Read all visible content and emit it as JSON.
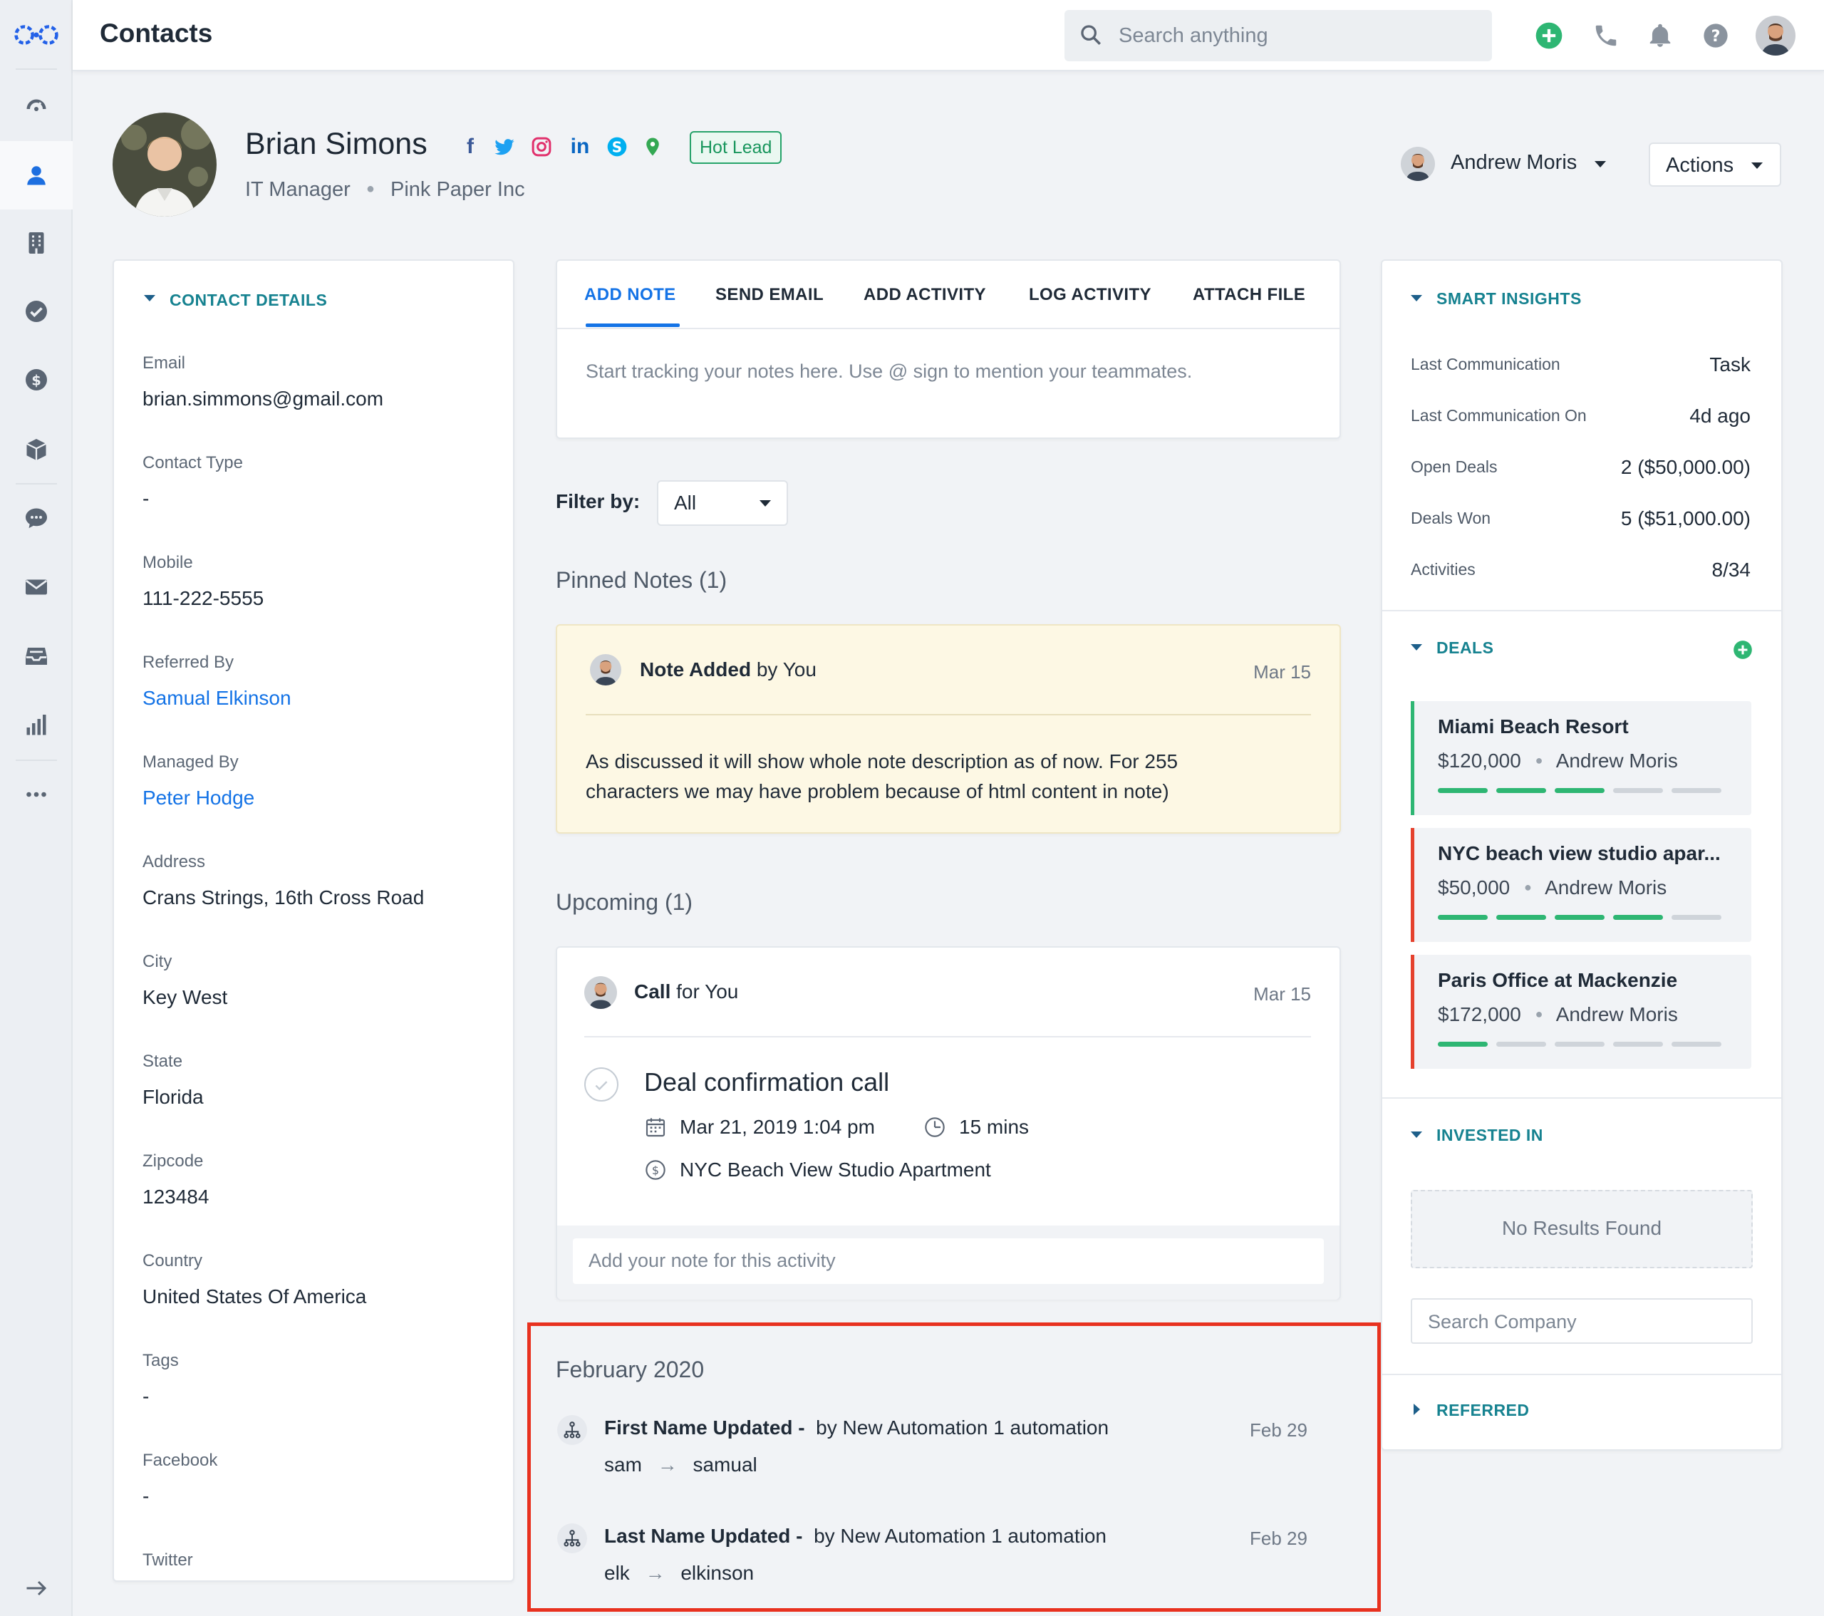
{
  "app": {
    "title": "Contacts"
  },
  "search": {
    "placeholder": "Search anything"
  },
  "contact": {
    "name": "Brian Simons",
    "job_title": "IT Manager",
    "company": "Pink Paper Inc",
    "badge": "Hot Lead",
    "owner": "Andrew Moris",
    "actions_label": "Actions"
  },
  "contact_details": {
    "title": "CONTACT DETAILS",
    "fields": [
      {
        "label": "Email",
        "value": "brian.simmons@gmail.com"
      },
      {
        "label": "Contact Type",
        "value": "-"
      },
      {
        "label": "Mobile",
        "value": "111-222-5555"
      },
      {
        "label": "Referred By",
        "value": "Samual Elkinson"
      },
      {
        "label": "Managed By",
        "value": "Peter Hodge"
      },
      {
        "label": "Address",
        "value": "Crans Strings, 16th Cross Road"
      },
      {
        "label": "City",
        "value": "Key West"
      },
      {
        "label": "State",
        "value": "Florida"
      },
      {
        "label": "Zipcode",
        "value": "123484"
      },
      {
        "label": "Country",
        "value": "United States Of America"
      },
      {
        "label": "Tags",
        "value": "-"
      },
      {
        "label": "Facebook",
        "value": "-"
      },
      {
        "label": "Twitter",
        "value": ""
      }
    ]
  },
  "composer": {
    "tabs": [
      "ADD NOTE",
      "SEND EMAIL",
      "ADD ACTIVITY",
      "LOG ACTIVITY",
      "ATTACH FILE"
    ],
    "placeholder": "Start tracking your notes here. Use @ sign to mention your teammates."
  },
  "filter": {
    "label": "Filter by:",
    "value": "All"
  },
  "pinned": {
    "heading": "Pinned Notes (1)",
    "note_title": "Note Added",
    "note_by": "by You",
    "date": "Mar 15",
    "body_line1": "As discussed it will show whole note description as of now. For 255",
    "body_line2": "characters we may have problem because of html content in note)"
  },
  "upcoming": {
    "heading": "Upcoming (1)",
    "activity_type": "Call",
    "activity_for": "for You",
    "date": "Mar 15",
    "title": "Deal confirmation call",
    "datetime": "Mar 21, 2019 1:04 pm",
    "duration": "15 mins",
    "deal": "NYC Beach View Studio Apartment",
    "note_placeholder": "Add your note for this activity"
  },
  "timeline": {
    "month": "February 2020",
    "items": [
      {
        "title": "First Name Updated -",
        "by": "by New Automation 1 automation",
        "date": "Feb 29",
        "from": "sam",
        "to": "samual"
      },
      {
        "title": "Last Name Updated -",
        "by": "by New Automation 1 automation",
        "date": "Feb 29",
        "from": "elk",
        "to": "elkinson"
      }
    ]
  },
  "insights": {
    "title": "SMART INSIGHTS",
    "rows": [
      {
        "label": "Last Communication",
        "value": "Task"
      },
      {
        "label": "Last Communication On",
        "value": "4d ago"
      },
      {
        "label": "Open Deals",
        "value": "2 ($50,000.00)"
      },
      {
        "label": "Deals Won",
        "value": "5 ($51,000.00)"
      },
      {
        "label": "Activities",
        "value": "8/34"
      }
    ]
  },
  "deals": {
    "title": "DEALS",
    "items": [
      {
        "name": "Miami Beach Resort",
        "amount": "$120,000",
        "owner": "Andrew Moris",
        "stage_progress": 3,
        "stage_total": 5,
        "status_color": "#2eb673"
      },
      {
        "name": "NYC beach view studio apar...",
        "amount": "$50,000",
        "owner": "Andrew Moris",
        "stage_progress": 4,
        "stage_total": 5,
        "status_color": "#e5412d"
      },
      {
        "name": "Paris Office at Mackenzie",
        "amount": "$172,000",
        "owner": "Andrew Moris",
        "stage_progress": 1,
        "stage_total": 5,
        "status_color": "#e5412d"
      }
    ]
  },
  "invested": {
    "title": "INVESTED IN",
    "empty": "No Results Found",
    "search_placeholder": "Search Company"
  },
  "referred": {
    "title": "REFERRED"
  },
  "colors": {
    "accent": "#1473e6",
    "teal_heading": "#168290",
    "highlight_box": "#e8311f",
    "pinned_bg": "#fdf8e4",
    "green": "#2eb673"
  }
}
